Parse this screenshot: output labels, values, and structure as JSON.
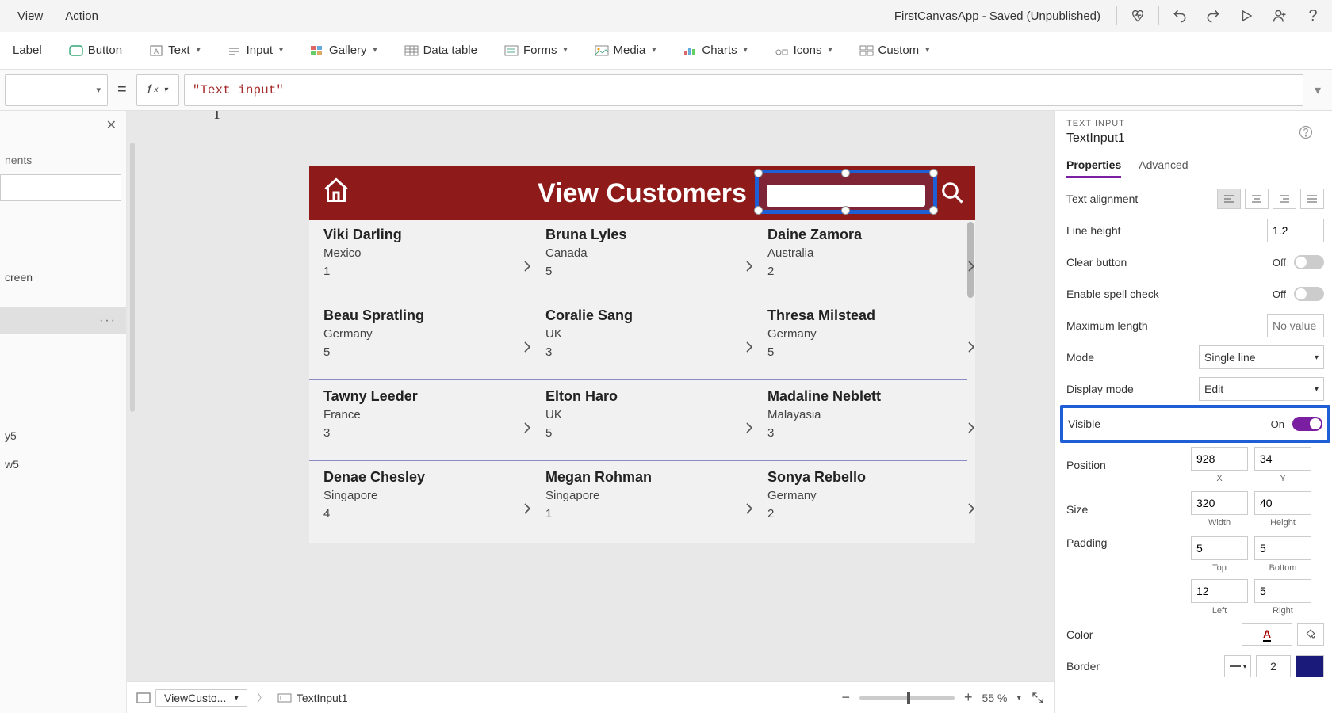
{
  "menubar": {
    "items": [
      "View",
      "Action"
    ],
    "app_title": "FirstCanvasApp - Saved (Unpublished)"
  },
  "ribbon": {
    "label": "Label",
    "button": "Button",
    "text": "Text",
    "input": "Input",
    "gallery": "Gallery",
    "datatable": "Data table",
    "forms": "Forms",
    "media": "Media",
    "charts": "Charts",
    "icons": "Icons",
    "custom": "Custom"
  },
  "formula": {
    "value": "\"Text input\""
  },
  "tree": {
    "header": "nents",
    "items": [
      "",
      "creen",
      "",
      "",
      "y5",
      "w5"
    ]
  },
  "canvas": {
    "header_title": "View Customers",
    "rows": [
      {
        "name": "Viki  Darling",
        "country": "Mexico",
        "num": "1"
      },
      {
        "name": "Bruna  Lyles",
        "country": "Canada",
        "num": "5"
      },
      {
        "name": "Daine  Zamora",
        "country": "Australia",
        "num": "2"
      },
      {
        "name": "Beau  Spratling",
        "country": "Germany",
        "num": "5"
      },
      {
        "name": "Coralie  Sang",
        "country": "UK",
        "num": "3"
      },
      {
        "name": "Thresa  Milstead",
        "country": "Germany",
        "num": "5"
      },
      {
        "name": "Tawny  Leeder",
        "country": "France",
        "num": "3"
      },
      {
        "name": "Elton  Haro",
        "country": "UK",
        "num": "5"
      },
      {
        "name": "Madaline  Neblett",
        "country": "Malayasia",
        "num": "3"
      },
      {
        "name": "Denae  Chesley",
        "country": "Singapore",
        "num": "4"
      },
      {
        "name": "Megan  Rohman",
        "country": "Singapore",
        "num": "1"
      },
      {
        "name": "Sonya  Rebello",
        "country": "Germany",
        "num": "2"
      }
    ]
  },
  "properties": {
    "type_label": "TEXT INPUT",
    "name": "TextInput1",
    "tabs": {
      "properties": "Properties",
      "advanced": "Advanced"
    },
    "text_alignment": "Text alignment",
    "line_height": {
      "label": "Line height",
      "value": "1.2"
    },
    "clear_button": {
      "label": "Clear button",
      "value": "Off"
    },
    "spell_check": {
      "label": "Enable spell check",
      "value": "Off"
    },
    "max_length": {
      "label": "Maximum length",
      "placeholder": "No value"
    },
    "mode": {
      "label": "Mode",
      "value": "Single line"
    },
    "display_mode": {
      "label": "Display mode",
      "value": "Edit"
    },
    "visible": {
      "label": "Visible",
      "value": "On"
    },
    "position": {
      "label": "Position",
      "x": "928",
      "y": "34",
      "xl": "X",
      "yl": "Y"
    },
    "size": {
      "label": "Size",
      "w": "320",
      "h": "40",
      "wl": "Width",
      "hl": "Height"
    },
    "padding": {
      "label": "Padding",
      "t": "5",
      "b": "5",
      "l": "12",
      "r": "5",
      "tl": "Top",
      "bl": "Bottom",
      "ll": "Left",
      "rl": "Right"
    },
    "color": {
      "label": "Color",
      "letter": "A"
    },
    "border": {
      "label": "Border",
      "value": "2"
    }
  },
  "bottombar": {
    "screen": "ViewCusto...",
    "crumb": "TextInput1",
    "zoom": "55",
    "zoom_suffix": "%"
  }
}
